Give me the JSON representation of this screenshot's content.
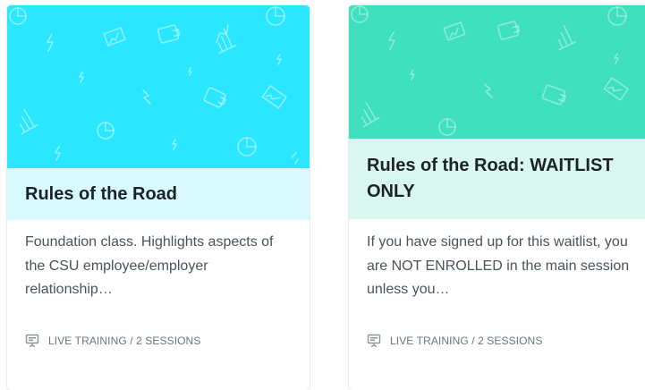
{
  "cards": [
    {
      "title": "Rules of the Road",
      "description": "Foundation class. Highlights aspects of the CSU employee/employer relationship…",
      "meta": "LIVE TRAINING / 2 SESSIONS",
      "icon": "presentation-board-icon",
      "banner_color": "#2ae6ff",
      "band_color": "#d8f9fd"
    },
    {
      "title": "Rules of the Road: WAITLIST ONLY",
      "description": "If you have signed up for this waitlist, you are NOT ENROLLED in the main session unless you…",
      "meta": "LIVE TRAINING / 2 SESSIONS",
      "icon": "presentation-board-icon",
      "banner_color": "#3ee0bd",
      "band_color": "#d9f7f0"
    }
  ]
}
